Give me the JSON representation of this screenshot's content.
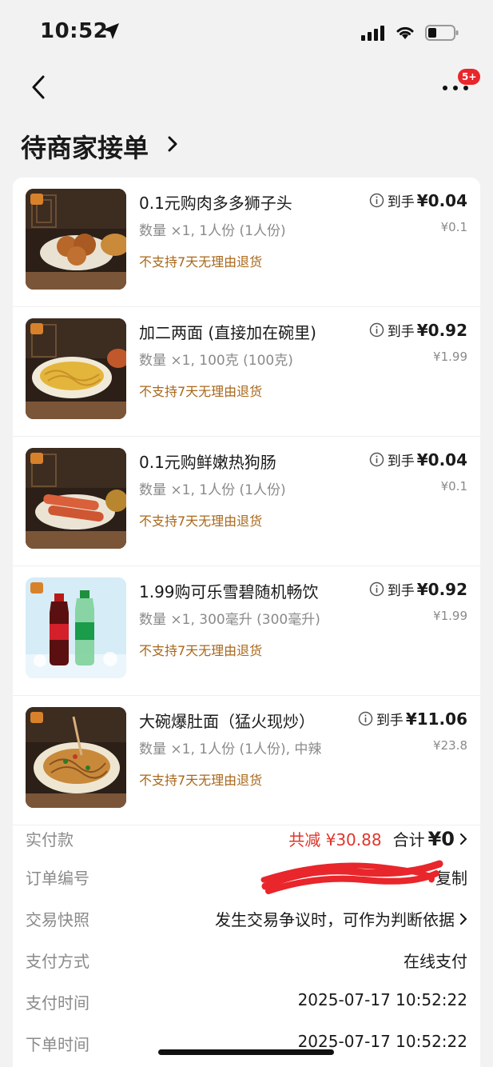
{
  "status": {
    "time": "10:52"
  },
  "nav": {
    "badge": "5+"
  },
  "title": "待商家接单",
  "items": [
    {
      "name": "0.1元购肉多多狮子头",
      "qty": "数量 ×1, 1人份 (1人份)",
      "policy": "不支持7天无理由退货",
      "net_label": "到手",
      "net_price": "¥0.04",
      "orig_price": "¥0.1"
    },
    {
      "name": "加二两面 (直接加在碗里)",
      "qty": "数量 ×1, 100克 (100克)",
      "policy": "不支持7天无理由退货",
      "net_label": "到手",
      "net_price": "¥0.92",
      "orig_price": "¥1.99"
    },
    {
      "name": "0.1元购鲜嫩热狗肠",
      "qty": "数量 ×1, 1人份 (1人份)",
      "policy": "不支持7天无理由退货",
      "net_label": "到手",
      "net_price": "¥0.04",
      "orig_price": "¥0.1"
    },
    {
      "name": "1.99购可乐雪碧随机畅饮",
      "qty": "数量 ×1, 300毫升 (300毫升)",
      "policy": "不支持7天无理由退货",
      "net_label": "到手",
      "net_price": "¥0.92",
      "orig_price": "¥1.99"
    },
    {
      "name": "大碗爆肚面（猛火现炒）",
      "qty": "数量 ×1, 1人份 (1人份), 中辣",
      "policy": "不支持7天无理由退货",
      "net_label": "到手",
      "net_price": "¥11.06",
      "orig_price": "¥23.8"
    }
  ],
  "summary": {
    "paid_label": "实付款",
    "discount": "共减 ¥30.88",
    "total_label": "合计",
    "total_value": "¥0",
    "order_no_label": "订单编号",
    "copy_label": "复制",
    "snapshot_label": "交易快照",
    "snapshot_value": "发生交易争议时，可作为判断依据",
    "pay_method_label": "支付方式",
    "pay_method_value": "在线支付",
    "pay_time_label": "支付时间",
    "pay_time_value": "2025-07-17 10:52:22",
    "order_time_label": "下单时间",
    "order_time_value": "2025-07-17 10:52:22"
  },
  "colors": {
    "accent_red": "#e0352b",
    "policy_brown": "#a8671a",
    "badge_red": "#e8262b"
  }
}
